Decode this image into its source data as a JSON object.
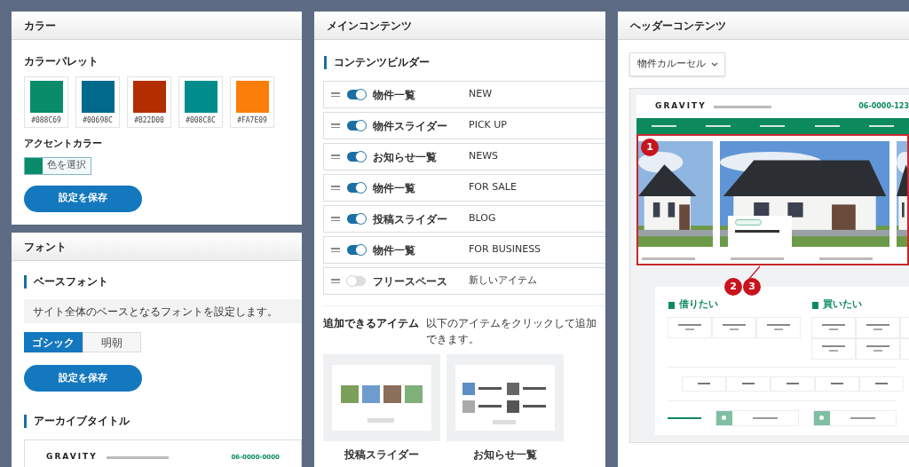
{
  "color_panel": {
    "title": "カラー",
    "palette_label": "カラーパレット",
    "swatches": [
      {
        "label": "#088C69",
        "color": "#088c69"
      },
      {
        "label": "#00698C",
        "color": "#00698c"
      },
      {
        "label": "#B22D00",
        "color": "#b22d00"
      },
      {
        "label": "#008C8C",
        "color": "#008c8c"
      },
      {
        "label": "#FA7E09",
        "color": "#fa7e09"
      }
    ],
    "accent_label": "アクセントカラー",
    "accent": {
      "color": "#088c69",
      "button": "色を選択"
    },
    "save_button": "設定を保存"
  },
  "font_panel": {
    "title": "フォント",
    "base_font_heading": "ベースフォント",
    "description": "サイト全体のベースとなるフォントを設定します。",
    "options": [
      {
        "label": "ゴシック",
        "selected": true
      },
      {
        "label": "明朝",
        "selected": false
      }
    ],
    "save_button": "設定を保存",
    "archive_heading": "アーカイブタイトル",
    "preview": {
      "logo": "GRAVITY",
      "phone": "06-0000-0000"
    }
  },
  "main_panel": {
    "title": "メインコンテンツ",
    "builder_heading": "コンテンツビルダー",
    "items": [
      {
        "name": "物件一覧",
        "label": "NEW",
        "on": true
      },
      {
        "name": "物件スライダー",
        "label": "PICK UP",
        "on": true
      },
      {
        "name": "お知らせ一覧",
        "label": "NEWS",
        "on": true
      },
      {
        "name": "物件一覧",
        "label": "FOR SALE",
        "on": true
      },
      {
        "name": "投稿スライダー",
        "label": "BLOG",
        "on": true
      },
      {
        "name": "物件一覧",
        "label": "FOR BUSINESS",
        "on": true
      },
      {
        "name": "フリースペース",
        "label": "新しいアイテム",
        "on": false
      }
    ],
    "addable_heading": "追加できるアイテム",
    "addable_hint": "以下のアイテムをクリックして追加できます。",
    "addable_items": [
      {
        "kind": "grid",
        "label": "投稿スライダー"
      },
      {
        "kind": "list",
        "label": "お知らせ一覧"
      }
    ]
  },
  "header_panel": {
    "title": "ヘッダーコンテンツ",
    "select": {
      "value": "物件カルーセル"
    },
    "preview": {
      "logo": "GRAVITY",
      "phone": "06-0000-123",
      "markers": [
        "1",
        "2",
        "3"
      ],
      "rent_heading": "借りたい",
      "buy_heading": "買いたい"
    }
  }
}
